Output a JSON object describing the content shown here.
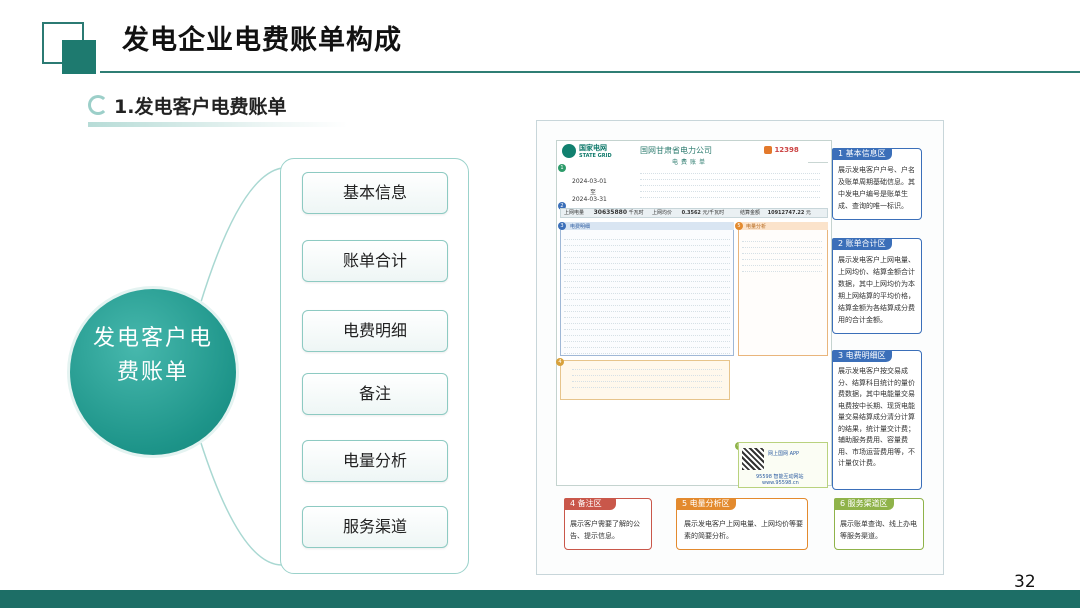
{
  "header": {
    "title": "发电企业电费账单构成",
    "section_title": "1.发电客户电费账单"
  },
  "diagram": {
    "center_label": "发电客户电费账单",
    "center_line1": "发电客户电",
    "center_line2": "费账单",
    "items": [
      "基本信息",
      "账单合计",
      "电费明细",
      "备注",
      "电量分析",
      "服务渠道"
    ]
  },
  "bill": {
    "company": "国网甘肃省电力公司",
    "bill_word": "电费账单",
    "logo_cn": "国家电网",
    "logo_en": "STATE GRID",
    "hotline": "12398",
    "date_start": "2024-03-01",
    "date_to": "至",
    "date_end": "2024-03-31",
    "summary": {
      "label1": "上网电量",
      "value1": "30635880",
      "unit1": "千瓦时",
      "label2": "上网均价",
      "value2": "0.3562",
      "unit2": "元/千瓦时",
      "label3": "结算金额",
      "value3": "10912747.22",
      "unit3": "元"
    },
    "detail_title": "电费明细",
    "analysis_title": "电量分析",
    "app_label": "网上国网 APP",
    "site_label": "95598 智能互动网站",
    "site_url": "www.95598.cn"
  },
  "callouts": [
    {
      "num": "1",
      "title": "基本信息区",
      "body": "展示发电客户户号、户名及账单周期基础信息。其中发电户编号是账单生成、查询的唯一标识。",
      "color": "#3b6fb9"
    },
    {
      "num": "2",
      "title": "账单合计区",
      "body": "展示发电客户上网电量、上网均价、结算金额合计数据，其中上网均价为本期上网结算的平均价格，结算金额为各结算成分费用的合计金额。",
      "color": "#3b6fb9"
    },
    {
      "num": "3",
      "title": "电费明细区",
      "body": "展示发电客户按交易成分、结算科目统计的量价费数据，其中电能量交易电费按中长期、现货电能量交易结算成分清分计算的结果，统计量交计费；辅助服务费用、容量费用、市场运营费用等，不计量仅计费。",
      "color": "#3b6fb9"
    },
    {
      "num": "4",
      "title": "备注区",
      "body": "展示客户需要了解的公告、提示信息。",
      "color": "#c9574a"
    },
    {
      "num": "5",
      "title": "电量分析区",
      "body": "展示发电客户上网电量、上网均价等要素的简要分析。",
      "color": "#e38a2e"
    },
    {
      "num": "6",
      "title": "服务渠道区",
      "body": "展示账单查询、线上办电等服务渠道。",
      "color": "#8fb34a"
    }
  ],
  "footer": {
    "page_number": "32"
  },
  "colors": {
    "brand": "#1e7a6f",
    "accent_light": "#9bd2cb"
  }
}
